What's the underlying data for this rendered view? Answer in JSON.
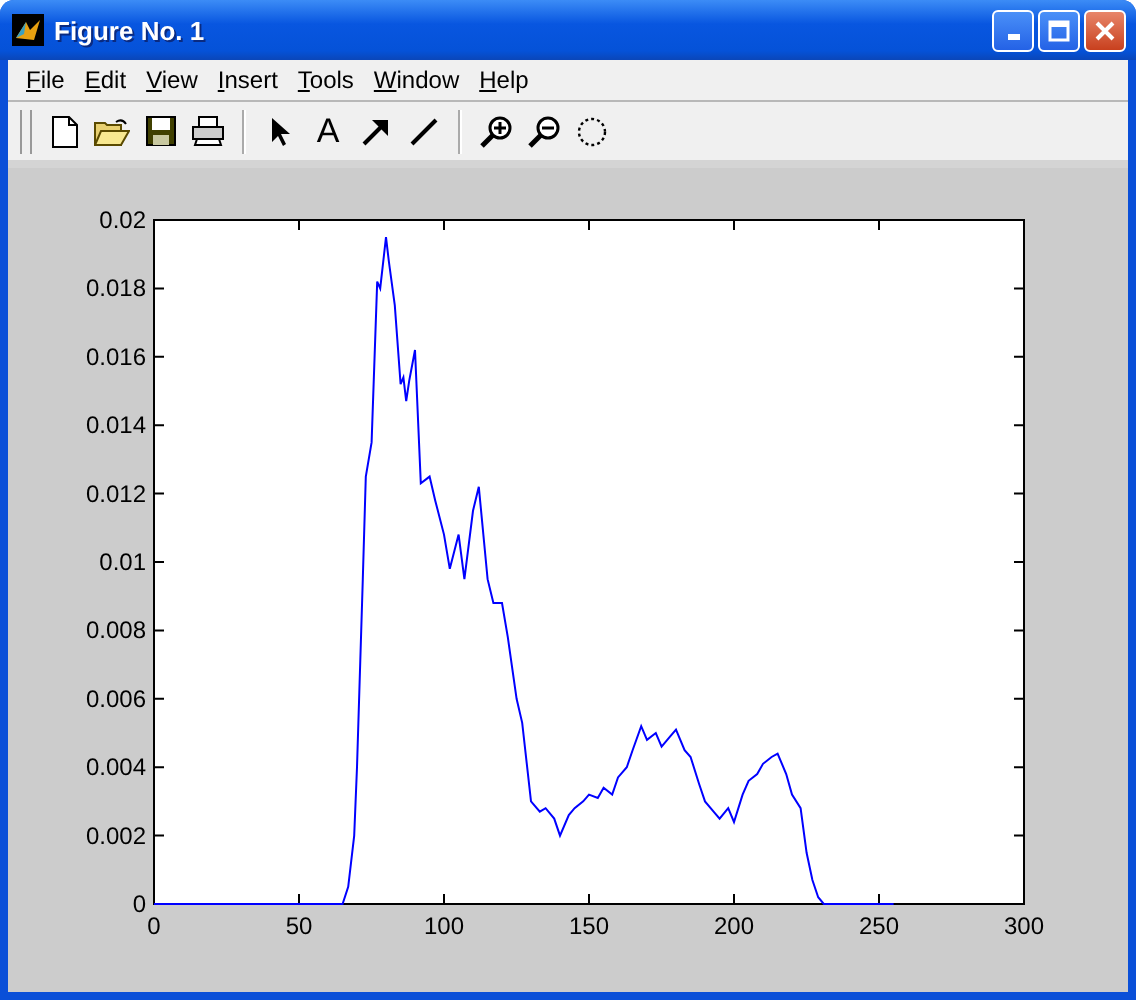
{
  "window": {
    "title": "Figure No. 1"
  },
  "menu": [
    {
      "label": "File"
    },
    {
      "label": "Edit"
    },
    {
      "label": "View"
    },
    {
      "label": "Insert"
    },
    {
      "label": "Tools"
    },
    {
      "label": "Window"
    },
    {
      "label": "Help"
    }
  ],
  "toolbar": {
    "text_tool_label": "A"
  },
  "plot": {
    "chart_data": {
      "type": "line",
      "x": [
        0,
        10,
        20,
        30,
        40,
        50,
        60,
        65,
        67,
        69,
        70,
        72,
        73,
        75,
        77,
        78,
        80,
        81,
        83,
        85,
        86,
        87,
        88,
        90,
        92,
        95,
        97,
        100,
        102,
        105,
        107,
        110,
        112,
        115,
        117,
        120,
        122,
        125,
        127,
        130,
        133,
        135,
        138,
        140,
        143,
        145,
        148,
        150,
        153,
        155,
        158,
        160,
        163,
        165,
        168,
        170,
        173,
        175,
        178,
        180,
        183,
        185,
        188,
        190,
        193,
        195,
        198,
        200,
        203,
        205,
        208,
        210,
        213,
        215,
        218,
        220,
        223,
        225,
        227,
        229,
        231,
        233,
        240,
        255
      ],
      "series": [
        {
          "color": "#0000ff",
          "values": [
            0,
            0,
            0,
            0,
            0,
            0,
            0,
            0,
            0.0005,
            0.002,
            0.004,
            0.0095,
            0.0125,
            0.0135,
            0.0182,
            0.018,
            0.0195,
            0.0188,
            0.0175,
            0.0152,
            0.0154,
            0.0147,
            0.0153,
            0.0162,
            0.0123,
            0.0125,
            0.0118,
            0.0108,
            0.0098,
            0.0108,
            0.0095,
            0.0115,
            0.0122,
            0.0095,
            0.0088,
            0.0088,
            0.0078,
            0.006,
            0.0053,
            0.003,
            0.0027,
            0.0028,
            0.0025,
            0.002,
            0.0026,
            0.0028,
            0.003,
            0.0032,
            0.0031,
            0.0034,
            0.0032,
            0.0037,
            0.004,
            0.0045,
            0.0052,
            0.0048,
            0.005,
            0.0046,
            0.0049,
            0.0051,
            0.0045,
            0.0043,
            0.0035,
            0.003,
            0.0027,
            0.0025,
            0.0028,
            0.0024,
            0.0032,
            0.0036,
            0.0038,
            0.0041,
            0.0043,
            0.0044,
            0.0038,
            0.0032,
            0.0028,
            0.0015,
            0.0007,
            0.0002,
            0,
            0,
            0,
            0
          ]
        }
      ],
      "xlim": [
        0,
        300
      ],
      "ylim": [
        0,
        0.02
      ],
      "xticks": [
        0,
        50,
        100,
        150,
        200,
        250,
        300
      ],
      "yticks": [
        0,
        0.002,
        0.004,
        0.006,
        0.008,
        0.01,
        0.012,
        0.014,
        0.016,
        0.018,
        0.02
      ]
    }
  }
}
